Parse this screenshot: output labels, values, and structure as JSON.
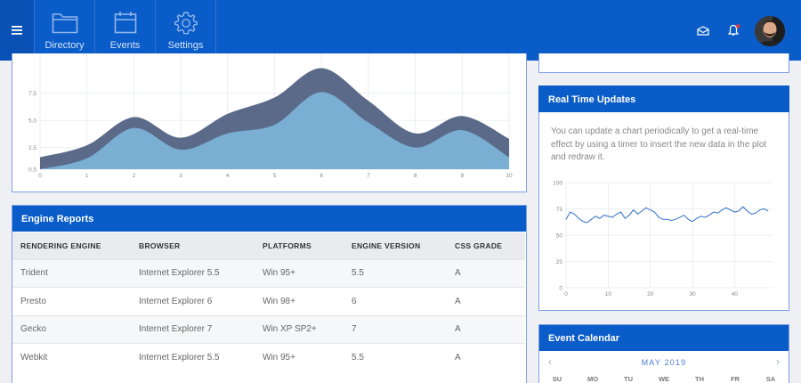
{
  "navbar": {
    "tabs": [
      {
        "label": "Directory",
        "icon": "folder-icon"
      },
      {
        "label": "Events",
        "icon": "calendar-icon"
      },
      {
        "label": "Settings",
        "icon": "gear-icon"
      }
    ],
    "icons": [
      "menu-icon",
      "mail-icon",
      "bell-icon",
      "avatar"
    ]
  },
  "area_chart": {
    "chart_data": {
      "type": "area",
      "x": [
        0,
        1,
        2,
        3,
        4,
        5,
        6,
        7,
        8,
        9,
        10
      ],
      "series": [
        {
          "name": "",
          "values": [
            0.5,
            1.5,
            4.3,
            2.3,
            3.8,
            4.6,
            7.6,
            4.8,
            2.5,
            4.1,
            1.6
          ]
        },
        {
          "name": "",
          "values": [
            1.6,
            2.7,
            5.3,
            3.4,
            5.6,
            7.1,
            9.8,
            6.8,
            3.8,
            5.4,
            3.3
          ]
        }
      ],
      "x_ticks": [
        "0",
        "1",
        "2",
        "3",
        "4",
        "5",
        "6",
        "7",
        "8",
        "9",
        "10"
      ],
      "y_ticks": [
        "0.5",
        "2.5",
        "5.0",
        "7.5"
      ],
      "colors": [
        "#7aaed3",
        "#5a6a88"
      ]
    }
  },
  "engine_reports": {
    "title": "Engine Reports",
    "columns": [
      "RENDERING ENGINE",
      "BROWSER",
      "PLATFORMS",
      "ENGINE VERSION",
      "CSS GRADE"
    ],
    "rows": [
      [
        "Trident",
        "Internet Explorer 5.5",
        "Win 95+",
        "5.5",
        "A"
      ],
      [
        "Presto",
        "Internet Explorer 6",
        "Win 98+",
        "6",
        "A"
      ],
      [
        "Gecko",
        "Internet Explorer 7",
        "Win XP SP2+",
        "7",
        "A"
      ],
      [
        "Webkit",
        "Internet Explorer 5.5",
        "Win 95+",
        "5.5",
        "A"
      ]
    ]
  },
  "realtime": {
    "title": "Real Time Updates",
    "description": "You can update a chart periodically to get a real-time effect by using a timer to insert the new data in the plot and redraw it.",
    "chart_data": {
      "type": "line",
      "x_ticks": [
        "0",
        "10",
        "20",
        "30",
        "40"
      ],
      "y_ticks": [
        "0",
        "25",
        "50",
        "75",
        "100"
      ],
      "ylim": [
        0,
        100
      ],
      "xlim": [
        0,
        49
      ],
      "values": [
        65,
        72,
        70,
        66,
        63,
        62,
        65,
        68,
        66,
        69,
        68,
        67,
        70,
        72,
        66,
        69,
        74,
        70,
        73,
        76,
        74,
        72,
        67,
        65,
        65,
        64,
        65,
        67,
        69,
        65,
        63,
        66,
        68,
        67,
        69,
        72,
        71,
        74,
        76,
        74,
        72,
        73,
        77,
        73,
        70,
        71,
        74,
        75,
        73
      ],
      "color": "#2f6fc8"
    }
  },
  "calendar": {
    "title": "Event Calendar",
    "month": "MAY 2019",
    "prev": "‹",
    "next": "›",
    "days": [
      "SU",
      "MO",
      "TU",
      "WE",
      "TH",
      "FR",
      "SA"
    ]
  }
}
